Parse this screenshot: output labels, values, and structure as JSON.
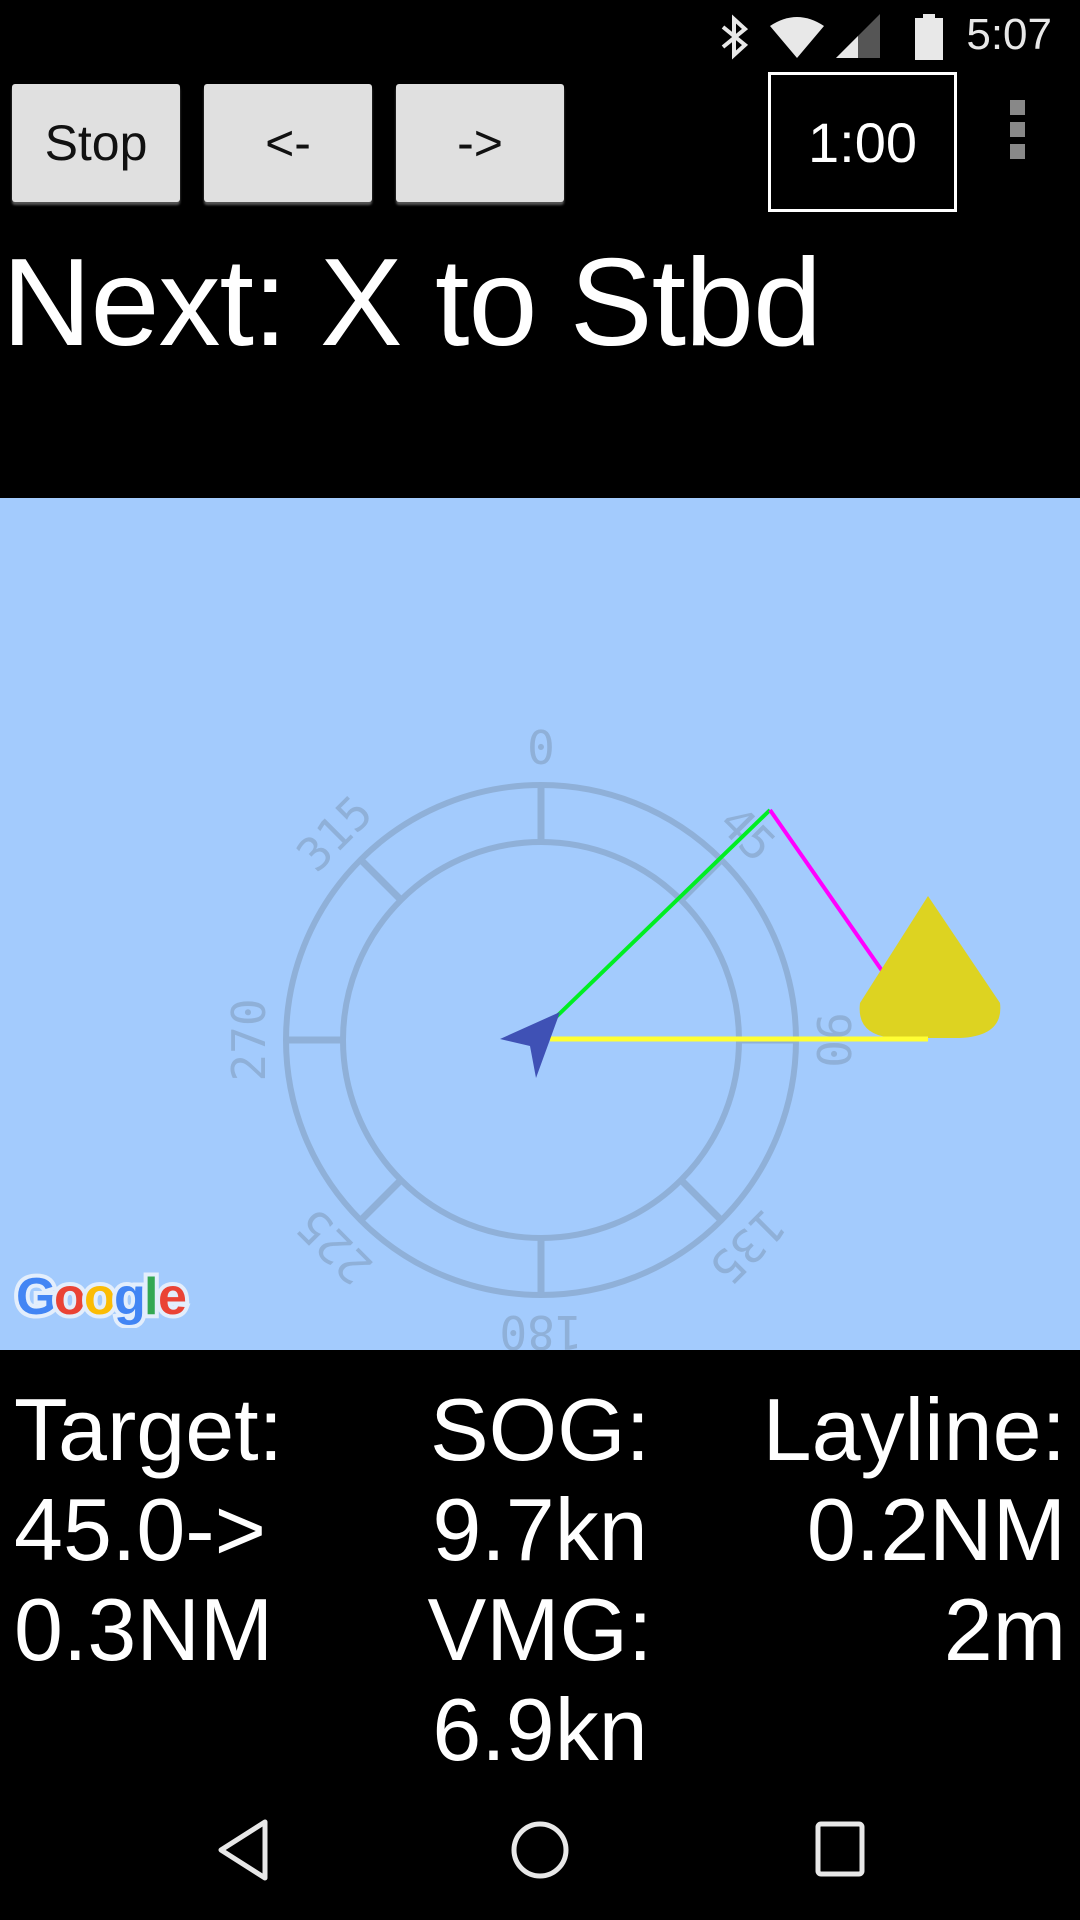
{
  "status_bar": {
    "time": "5:07",
    "icons": [
      "bluetooth-icon",
      "wifi-icon",
      "cell-signal-icon",
      "battery-icon"
    ]
  },
  "toolbar": {
    "stop_label": "Stop",
    "prev_label": "<-",
    "next_label": "->",
    "timer_value": "1:00",
    "overflow_icon": "more-vert-icon"
  },
  "next_instruction": "Next: X to Stbd",
  "map": {
    "provider_logo": "Google",
    "compass_labels": [
      "0",
      "45",
      "90",
      "135",
      "180",
      "225",
      "270",
      "315"
    ],
    "colors": {
      "water": "#a3cbfd",
      "course_line": "#00ee22",
      "layline_line": "#ff00ff",
      "target_line": "#ffff33",
      "mark": "#ddd321",
      "boat": "#3f51b5",
      "compass": "#8fb0d8"
    }
  },
  "stats": {
    "target_label": "Target:",
    "target_bearing": "45.0->",
    "target_distance": "0.3NM",
    "sog_label": "SOG:",
    "sog_value": "9.7kn",
    "vmg_label": "VMG:",
    "vmg_value": "6.9kn",
    "layline_label": "Layline:",
    "layline_distance": "0.2NM",
    "layline_time": "2m"
  },
  "nav_bar": {
    "back": "back-icon",
    "home": "home-icon",
    "recents": "recents-icon"
  }
}
